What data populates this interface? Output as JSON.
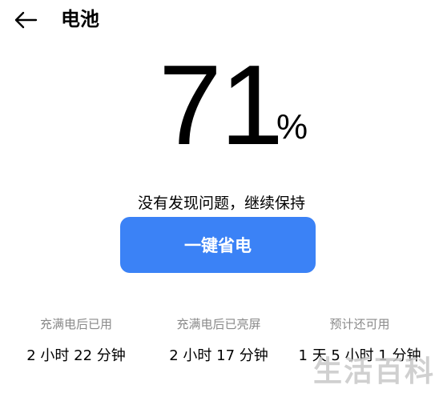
{
  "header": {
    "title": "电池",
    "back_icon": "arrow-left-icon"
  },
  "battery": {
    "percent_value": "71",
    "percent_sign": "%",
    "status": "没有发现问题，继续保持"
  },
  "power_saver": {
    "label": "一键省电",
    "color": "#3b82f6"
  },
  "stats": [
    {
      "label": "充满电后已用",
      "value": "2 小时 22 分钟"
    },
    {
      "label": "充满电后已亮屏",
      "value": "2 小时 17 分钟"
    },
    {
      "label": "预计还可用",
      "value": "1 天 5 小时 1 分钟"
    }
  ],
  "watermark": "生活百科"
}
